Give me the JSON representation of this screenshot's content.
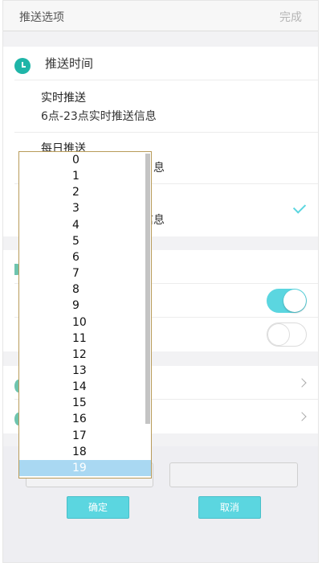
{
  "header": {
    "title": "推送选项",
    "done": "完成"
  },
  "push_time": {
    "title": "推送时间",
    "options": [
      {
        "title": "实时推送",
        "desc": "6点-23点实时推送信息"
      },
      {
        "title": "每日推送",
        "desc_visible": "息"
      },
      {
        "desc_visible": "送信息",
        "checked": true
      }
    ]
  },
  "toggles": {
    "first_on": true,
    "second_on": false
  },
  "bottom": {
    "confirm": "确定",
    "cancel": "取消"
  },
  "dropdown": {
    "items": [
      "0",
      "1",
      "2",
      "3",
      "4",
      "5",
      "6",
      "7",
      "8",
      "9",
      "10",
      "11",
      "12",
      "13",
      "14",
      "15",
      "16",
      "17",
      "18",
      "19"
    ],
    "selected": "19"
  },
  "colors": {
    "accent": "#5bd6e0",
    "icon_teal": "#1fb5a8",
    "selection": "#a9d8f2"
  }
}
